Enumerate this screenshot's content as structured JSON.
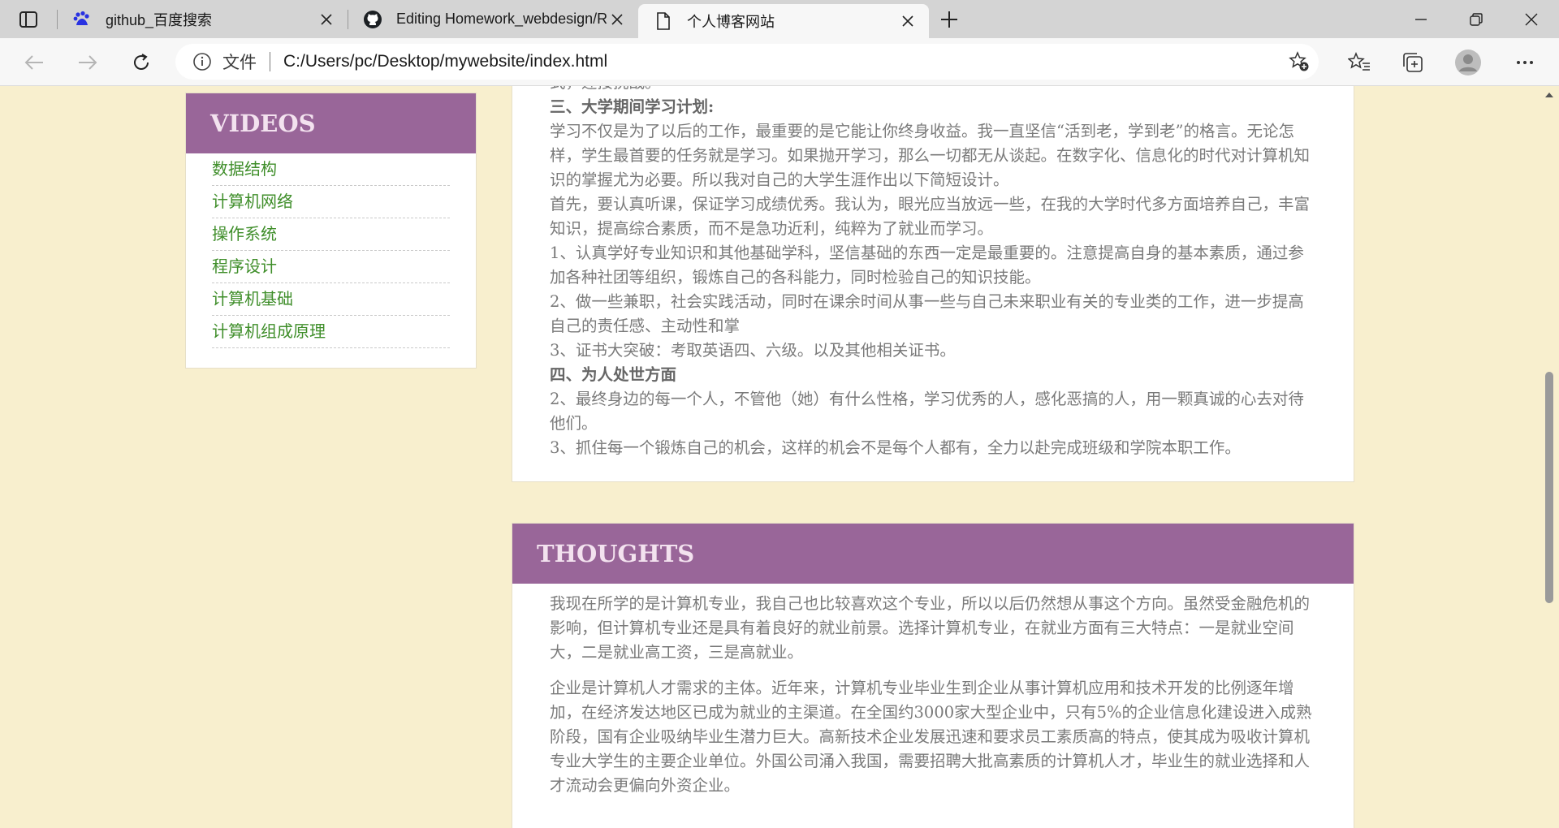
{
  "browser": {
    "tabs": [
      {
        "title": "github_百度搜索",
        "icon": "baidu-icon",
        "active": false
      },
      {
        "title": "Editing Homework_webdesign/R",
        "icon": "github-icon",
        "active": false
      },
      {
        "title": "个人博客网站",
        "icon": "page-icon",
        "active": true
      }
    ],
    "address": {
      "protocol_label": "文件",
      "url": "C:/Users/pc/Desktop/mywebsite/index.html"
    }
  },
  "sidebar": {
    "heading": "VIDEOS",
    "items": [
      "数据结构",
      "计算机网络",
      "操作系统",
      "程序设计",
      "计算机基础",
      "计算机组成原理"
    ]
  },
  "article": {
    "partial_top": "式，迎接挑战。",
    "lines": [
      {
        "text": "三、大学期间学习计划:",
        "heading": true
      },
      {
        "text": "学习不仅是为了以后的工作，最重要的是它能让你终身收益。我一直坚信“活到老，学到老”的格言。无论怎样，学生最首要的任务就是学习。如果抛开学习，那么一切都无从谈起。在数字化、信息化的时代对计算机知识的掌握尤为必要。所以我对自己的大学生涯作出以下简短设计。",
        "heading": false
      },
      {
        "text": "首先，要认真听课，保证学习成绩优秀。我认为，眼光应当放远一些，在我的大学时代多方面培养自己，丰富知识，提高综合素质，而不是急功近利，纯粹为了就业而学习。",
        "heading": false
      },
      {
        "text": "1、认真学好专业知识和其他基础学科，坚信基础的东西一定是最重要的。注意提高自身的基本素质，通过参加各种社团等组织，锻炼自己的各科能力，同时检验自己的知识技能。",
        "heading": false
      },
      {
        "text": "2、做一些兼职，社会实践活动，同时在课余时间从事一些与自己未来职业有关的专业类的工作，进一步提高自己的责任感、主动性和掌",
        "heading": false
      },
      {
        "text": "3、证书大突破：考取英语四、六级。以及其他相关证书。",
        "heading": false
      },
      {
        "text": "四、为人处世方面",
        "heading": true
      },
      {
        "text": "2、最终身边的每一个人，不管他（她）有什么性格，学习优秀的人，感化恶搞的人，用一颗真诚的心去对待他们。",
        "heading": false
      },
      {
        "text": "3、抓住每一个锻炼自己的机会，这样的机会不是每个人都有，全力以赴完成班级和学院本职工作。",
        "heading": false
      }
    ]
  },
  "thoughts": {
    "heading": "THOUGHTS",
    "paragraphs": [
      "我现在所学的是计算机专业，我自己也比较喜欢这个专业，所以以后仍然想从事这个方向。虽然受金融危机的影响，但计算机专业还是具有着良好的就业前景。选择计算机专业，在就业方面有三大特点：一是就业空间大，二是就业高工资，三是高就业。",
      "企业是计算机人才需求的主体。近年来，计算机专业毕业生到企业从事计算机应用和技术开发的比例逐年增加，在经济发达地区已成为就业的主渠道。在全国约3000家大型企业中，只有5%的企业信息化建设进入成熟阶段，国有企业吸纳毕业生潜力巨大。高新技术企业发展迅速和要求员工素质高的特点，使其成为吸收计算机专业大学生的主要企业单位。外国公司涌入我国，需要招聘大批高素质的计算机人才，毕业生的就业选择和人才流动会更偏向外资企业。"
    ]
  },
  "colors": {
    "page_bg": "#f8efce",
    "header_purple": "#996699",
    "link_green": "#3f8e2a",
    "body_text": "#7a7a7a"
  }
}
